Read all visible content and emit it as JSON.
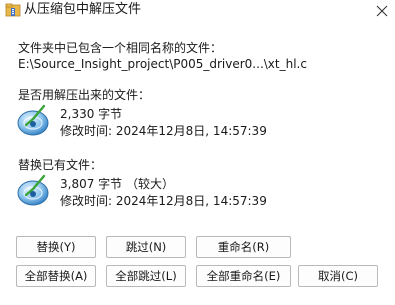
{
  "window": {
    "title": "从压缩包中解压文件"
  },
  "prompt": {
    "line1": "文件夹中已包含一个相同名称的文件：",
    "path": "E:\\Source_Insight_project\\P005_driver0...\\xt_hl.c"
  },
  "replace_prompt": "是否用解压出来的文件：",
  "new_file": {
    "size": "2,330 字节",
    "modified": "修改时间: 2024年12月8日, 14:57:39"
  },
  "existing_prompt": "替换已有文件：",
  "existing_file": {
    "size": "3,807 字节 （较大）",
    "modified": "修改时间: 2024年12月8日, 14:57:39"
  },
  "buttons": {
    "replace": "替换(Y)",
    "skip": "跳过(N)",
    "rename": "重命名(R)",
    "replace_all": "全部替换(A)",
    "skip_all": "全部跳过(L)",
    "rename_all": "全部重命名(E)",
    "cancel": "取消(C)"
  },
  "icons": {
    "title": "archive-folder-icon",
    "close": "close-icon",
    "file": "globe-file-icon"
  }
}
